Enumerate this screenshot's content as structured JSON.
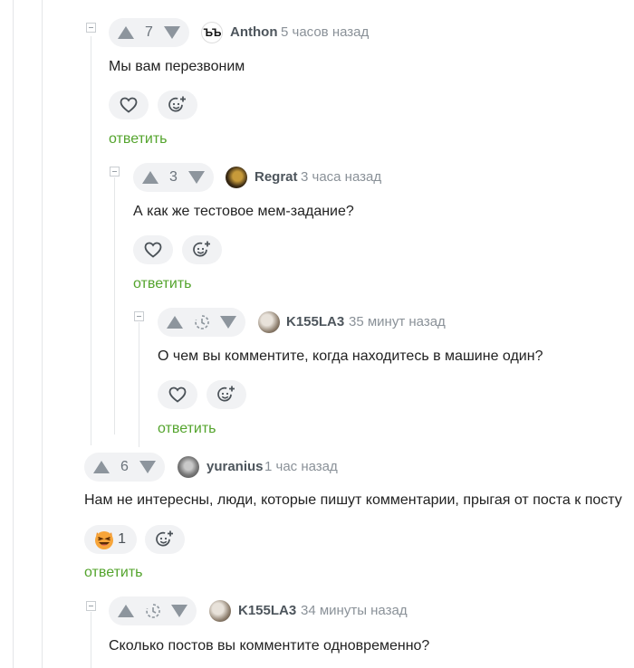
{
  "comments": [
    {
      "id": "c1",
      "score": "7",
      "user": "Anthon",
      "time": "5 часов назад",
      "text": "Мы вам перезвоним",
      "reply": "ответить",
      "avatar_text": "ЪЪ"
    },
    {
      "id": "c2",
      "score": "3",
      "user": "Regrat",
      "time": "3 часа назад",
      "text": "А как же тестовое мем-задание?",
      "reply": "ответить"
    },
    {
      "id": "c3",
      "score": "",
      "user": "K155LA3",
      "time": "35 минут назад",
      "text": "О чем вы комментите, когда находитесь в машине один?",
      "reply": "ответить"
    },
    {
      "id": "c4",
      "score": "6",
      "user": "yuranius",
      "time": "1 час назад",
      "text": "Нам не интересны, люди, которые пишут комментарии, прыгая от поста к посту",
      "reply": "ответить",
      "reaction_count": "1"
    },
    {
      "id": "c5",
      "score": "",
      "user": "K155LA3",
      "time": "34 минуты назад",
      "text": "Сколько постов вы комментите одновременно?"
    }
  ],
  "icons": {
    "upvote": "triangle-up-icon",
    "downvote": "triangle-down-icon",
    "pending": "clock-icon",
    "like": "heart-icon",
    "add_reaction": "smiley-plus-icon",
    "collapse": "minus-box-icon"
  },
  "colors": {
    "reply_link": "#54a42d",
    "vote_bg": "#f1f2f4",
    "username": "#4d555c",
    "time": "#8a9198"
  }
}
